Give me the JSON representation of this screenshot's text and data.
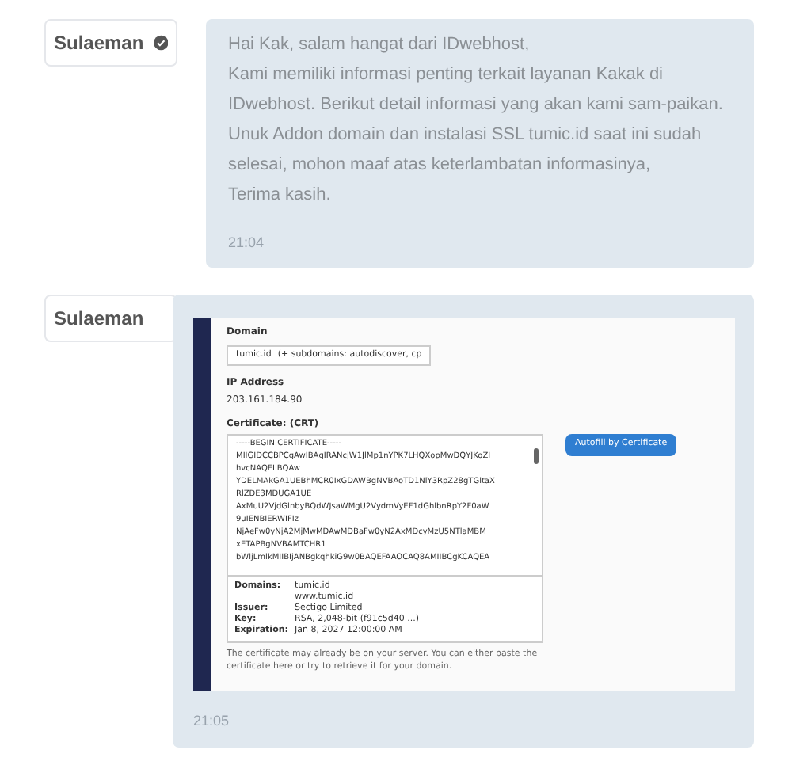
{
  "messages": [
    {
      "kind": "text",
      "sender": {
        "name": "Sulaeman",
        "verified": true
      },
      "lines": [
        "Hai Kak, salam hangat dari IDwebhost,",
        "Kami memiliki informasi penting terkait layanan Kakak di IDwebhost. Berikut detail informasi yang akan kami sam-paikan.",
        "Unuk Addon domain dan instalasi SSL tumic.id saat ini sudah selesai, mohon maaf atas keterlambatan informasinya,",
        "Terima kasih."
      ],
      "time": "21:04"
    },
    {
      "kind": "screenshot",
      "sender": {
        "name": "Sulaeman",
        "verified": false
      },
      "time": "21:05",
      "screenshot": {
        "domain_label": "Domain",
        "domain_value": "tumic.id",
        "domain_extra": "(+ subdomains: autodiscover, cp",
        "ip_label": "IP Address",
        "ip_value": "203.161.184.90",
        "certificate_label": "Certificate: (CRT)",
        "certificate_lines": [
          "-----BEGIN CERTIFICATE-----",
          "MIIGIDCCBPCgAwIBAgIRANcjW1JlMp1nYPK7LHQXopMwDQYJKoZI",
          "hvcNAQELBQAw",
          "YDELMAkGA1UEBhMCR0IxGDAWBgNVBAoTD1NlY3RpZ28gTGltaX",
          "RlZDE3MDUGA1UE",
          "AxMuU2VjdGlnbyBQdWJsaWMgU2VydmVyEF1dGhlbnRpY2F0aW",
          "9uIENBIERWIFIz",
          "NjAeFw0yNjA2MjMwMDAwMDBaFw0yN2AxMDcyMzU5NTlaMBM",
          "xETAPBgNVBAMTCHR1",
          "bWljLmlkMIIBIjANBgkqhkiG9w0BAQEFAAOCAQ8AMIIBCgKCAQEA"
        ],
        "details": [
          {
            "label": "Domains:",
            "values": [
              "tumic.id",
              "www.tumic.id"
            ]
          },
          {
            "label": "Issuer:",
            "values": [
              "Sectigo Limited"
            ]
          },
          {
            "label": "Key:",
            "values": [
              "RSA, 2,048-bit (f91c5d40 ...)"
            ]
          },
          {
            "label": "Expiration:",
            "values": [
              "Jan 8, 2027 12:00:00 AM"
            ]
          }
        ],
        "note": "The certificate may already be on your server. You can either paste the certificate here or try to retrieve it for your domain.",
        "autofill_button": "Autofill by Certificate"
      }
    }
  ]
}
